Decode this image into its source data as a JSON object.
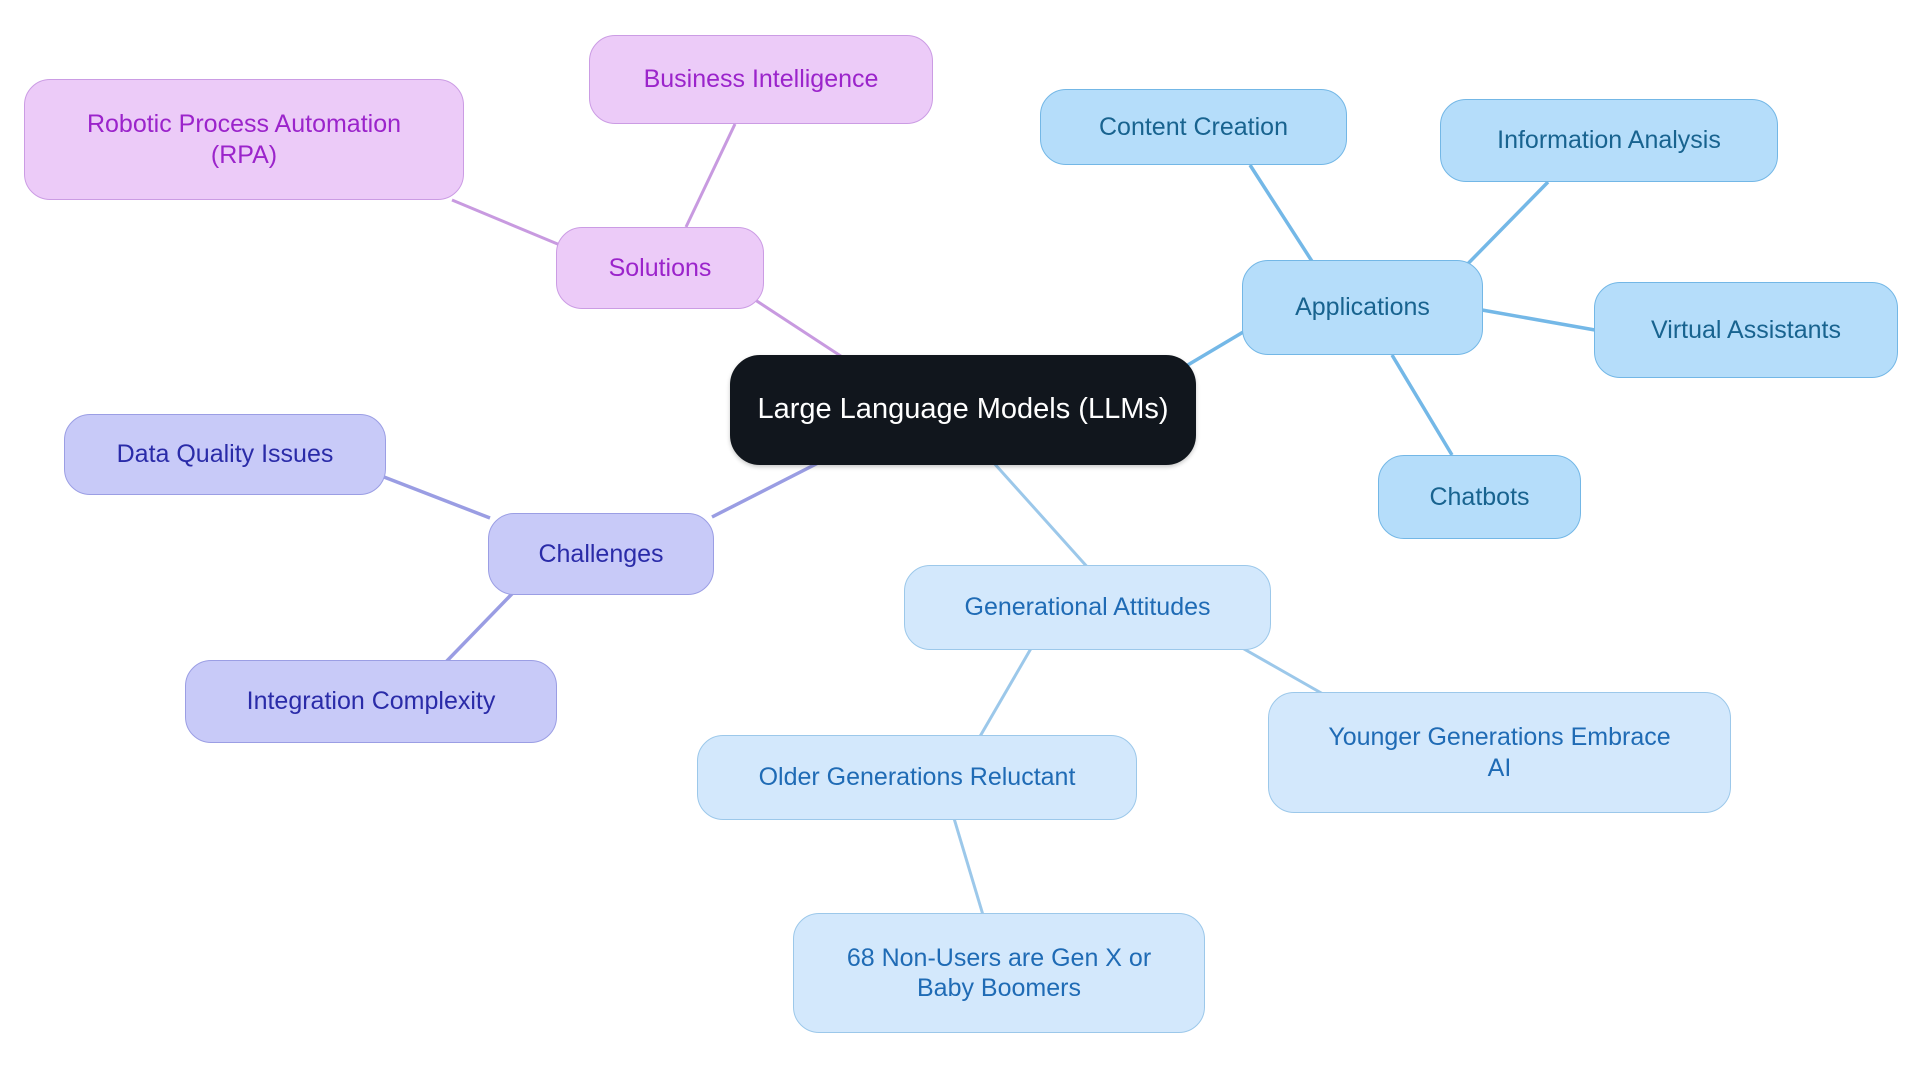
{
  "diagram": {
    "type": "mindmap",
    "title": "Large Language Models (LLMs)",
    "background": "#ffffff",
    "palettes": {
      "root": {
        "fill": "#11161d",
        "text": "#ffffff",
        "border": "#11161d"
      },
      "sky": {
        "fill": "#b5ddfa",
        "text": "#18638f",
        "border": "#73b7e6"
      },
      "pale": {
        "fill": "#d3e8fc",
        "text": "#1f6bb5",
        "border": "#9cc8ea"
      },
      "lavender": {
        "fill": "#eccbf8",
        "text": "#9b24cb",
        "border": "#cb9ce4"
      },
      "periwinkle": {
        "fill": "#c8caf8",
        "text": "#2a2ba8",
        "border": "#9b9ee4"
      }
    }
  },
  "nodes": {
    "root": {
      "label": "Large Language Models (LLMs)"
    },
    "solutions": {
      "label": "Solutions"
    },
    "rpa": {
      "label": "Robotic Process Automation\n(RPA)"
    },
    "business_intelligence": {
      "label": "Business Intelligence"
    },
    "applications": {
      "label": "Applications"
    },
    "content_creation": {
      "label": "Content Creation"
    },
    "information_analysis": {
      "label": "Information Analysis"
    },
    "virtual_assistants": {
      "label": "Virtual Assistants"
    },
    "chatbots": {
      "label": "Chatbots"
    },
    "challenges": {
      "label": "Challenges"
    },
    "data_quality_issues": {
      "label": "Data Quality Issues"
    },
    "integration_complexity": {
      "label": "Integration Complexity"
    },
    "generational_attitudes": {
      "label": "Generational Attitudes"
    },
    "older_generations_reluctant": {
      "label": "Older Generations Reluctant"
    },
    "younger_generations_embrace_ai": {
      "label": "Younger Generations Embrace\nAI"
    },
    "non_users_stat": {
      "label": "68 Non-Users are Gen X or\nBaby Boomers"
    }
  },
  "edges": [
    {
      "from": "root",
      "to": "solutions",
      "color": "#c89ae0"
    },
    {
      "from": "solutions",
      "to": "rpa",
      "color": "#c89ae0"
    },
    {
      "from": "solutions",
      "to": "business_intelligence",
      "color": "#c89ae0"
    },
    {
      "from": "root",
      "to": "applications",
      "color": "#74b8e7"
    },
    {
      "from": "applications",
      "to": "content_creation",
      "color": "#74b8e7"
    },
    {
      "from": "applications",
      "to": "information_analysis",
      "color": "#74b8e7"
    },
    {
      "from": "applications",
      "to": "virtual_assistants",
      "color": "#74b8e7"
    },
    {
      "from": "applications",
      "to": "chatbots",
      "color": "#74b8e7"
    },
    {
      "from": "root",
      "to": "challenges",
      "color": "#9a9de3"
    },
    {
      "from": "challenges",
      "to": "data_quality_issues",
      "color": "#9a9de3"
    },
    {
      "from": "challenges",
      "to": "integration_complexity",
      "color": "#9a9de3"
    },
    {
      "from": "root",
      "to": "generational_attitudes",
      "color": "#9cc8ea"
    },
    {
      "from": "generational_attitudes",
      "to": "older_generations_reluctant",
      "color": "#9cc8ea"
    },
    {
      "from": "generational_attitudes",
      "to": "younger_generations_embrace_ai",
      "color": "#9cc8ea"
    },
    {
      "from": "older_generations_reluctant",
      "to": "non_users_stat",
      "color": "#9cc8ea"
    }
  ]
}
